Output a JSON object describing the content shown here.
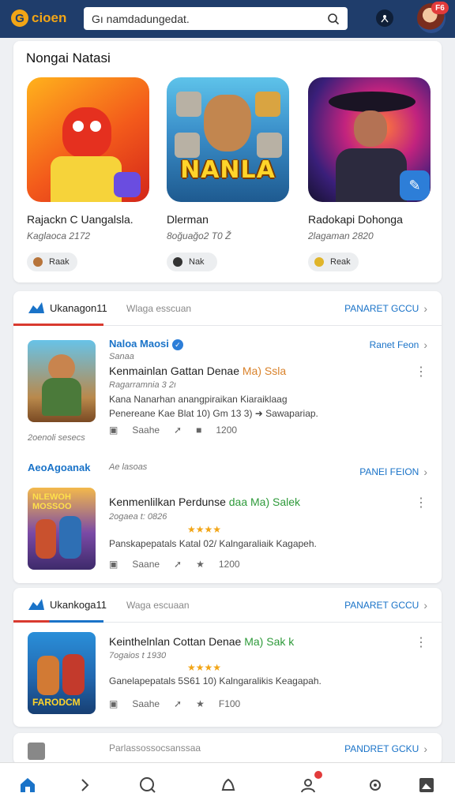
{
  "app": {
    "logo_letter": "G",
    "logo_text": "cioen"
  },
  "search": {
    "value": "Gı namdadungedat."
  },
  "notifications": {
    "badge": "F6"
  },
  "featured": {
    "title": "Nongai Natasi",
    "games": [
      {
        "name": "Rajackn C Uangalsla.",
        "date": "Kaglaoca 2172",
        "button": "Raak",
        "tile_text": ""
      },
      {
        "name": "Dlerman",
        "date": "8oğuağo2 T0 Ž",
        "button": "Nak",
        "tile_text": "NANLA"
      },
      {
        "name": "Radokapi Dohonga",
        "date": "2lagaman 2820",
        "button": "Reak",
        "tile_text": ""
      }
    ]
  },
  "section1": {
    "title": "Ukanagon11",
    "subtitle": "Wlaga esscuan",
    "link": "PANARET GCCU",
    "entries": [
      {
        "author": "Naloa Maosi",
        "meta_sub": "Sanaa",
        "link": "Ranet Feon",
        "title": "Kenmainlan Gattan Denae",
        "title_hl": "Ma) Ssla",
        "meta": "Ragarramnia 3 2ı",
        "desc1": "Kana Nanarhan anangpiraikan Kiaraiklaag",
        "desc2": "Penereane Kae Blat 10) Gm 13 3) ➜ Sawapariap.",
        "share": "Saahe",
        "count": "1200",
        "caption": "2oenoli sesecs"
      },
      {
        "author": "AeoAgoanak",
        "meta_sub": "Ae lasoas",
        "link": "PANEI FEION",
        "title": "Kenmenlilkan Perdunse",
        "title_hl": "daa Ma) Salek",
        "meta": "2ogaea t: 0826",
        "stars": "★★★★",
        "desc1": "Panskapepatals Katal 02/ Kalngaraliaik Kagapeh.",
        "share": "Saane",
        "count": "1200",
        "thumb_text": "NLEWOH MOSSOO"
      }
    ]
  },
  "section2": {
    "title": "Ukankoga11",
    "subtitle": "Waga escuaan",
    "link": "PANARET GCCU",
    "entry": {
      "title": "Keinthelnlan Cottan Denae",
      "title_hl": "Ma) Sak k",
      "meta": "7ogaios t 1930",
      "stars": "★★★★",
      "desc1": "Ganelapepatals 5S61 10) Kalngaralikis Keagapah.",
      "share": "Saahe",
      "count": "F100",
      "thumb_text": "FARODCM"
    }
  },
  "section3": {
    "subtitle": "Parlassossocsanssaa",
    "link": "PANDRET GCKU"
  },
  "colors": {
    "topbar": "#1f3d6b",
    "accent": "#1a73c8",
    "brand": "#f2a516",
    "red": "#d93a2f"
  },
  "icons": [
    "g-logo-icon",
    "search-icon",
    "account-icon",
    "avatar",
    "chevron-right-icon",
    "kebab-icon",
    "verified-icon",
    "share-icon",
    "forward-icon",
    "bookmark-icon",
    "home-icon",
    "explore-icon",
    "notification-icon",
    "profile-icon",
    "settings-icon",
    "library-icon"
  ]
}
